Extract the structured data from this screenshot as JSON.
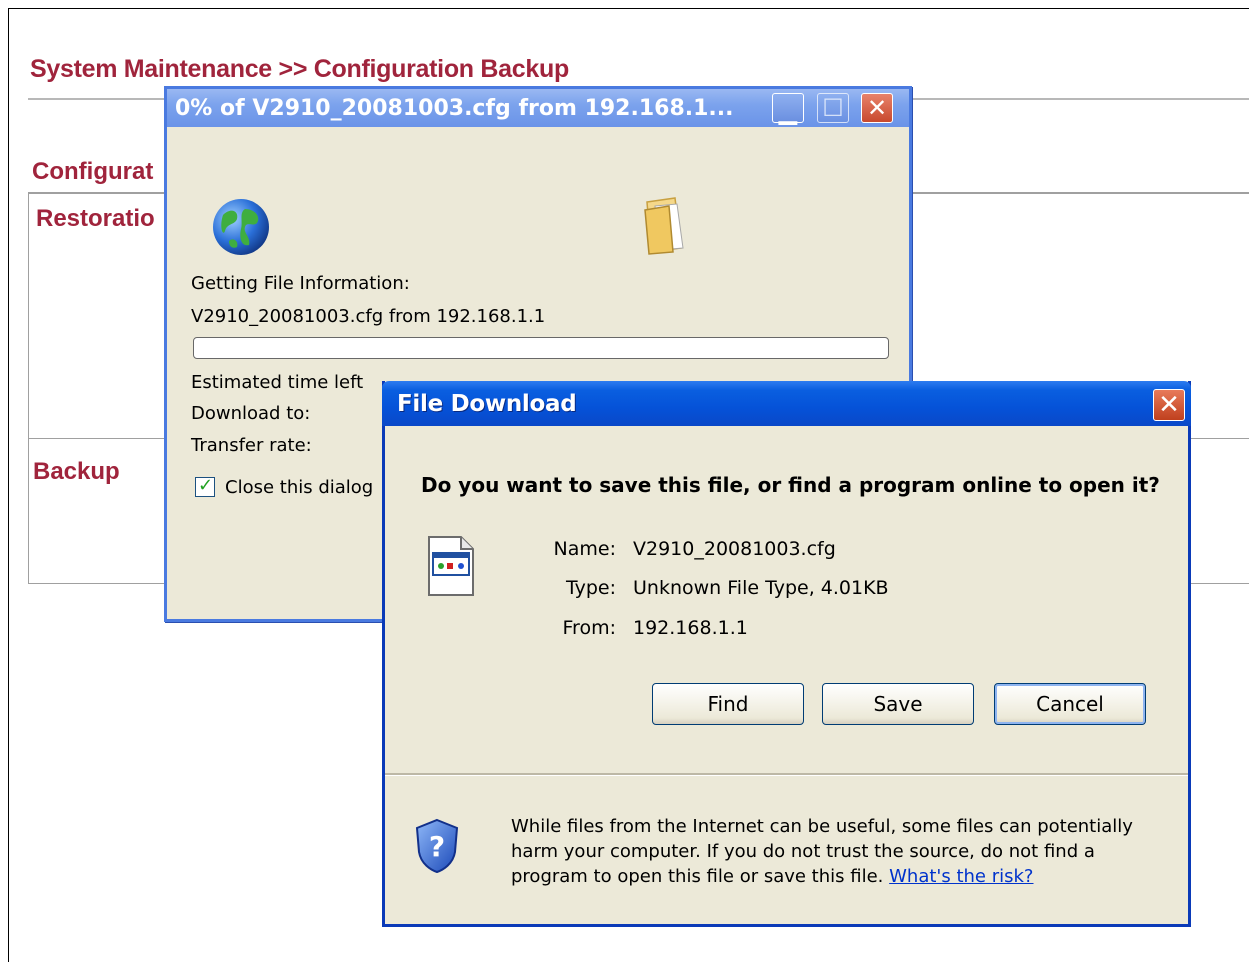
{
  "page": {
    "title": "System Maintenance >> Configuration Backup",
    "section_config": "Configurat",
    "section_restoration": "Restoratio",
    "section_backup": "Backup"
  },
  "progress_window": {
    "title": "0% of V2910_20081003.cfg from 192.168.1...",
    "status_label": "Getting File Information:",
    "file_source": "V2910_20081003.cfg from 192.168.1.1",
    "progress_percent": 0,
    "estimated_time_label": "Estimated time left",
    "download_to_label": "Download to:",
    "transfer_rate_label": "Transfer rate:",
    "close_dialog_label": "Close this dialog",
    "close_dialog_checked": true,
    "icons": {
      "globe": "globe-icon",
      "folder": "folder-icon"
    }
  },
  "file_download_dialog": {
    "title": "File Download",
    "question": "Do you want to save this file, or find a program online to open it?",
    "name_label": "Name:",
    "name_value": "V2910_20081003.cfg",
    "type_label": "Type:",
    "type_value": "Unknown File Type, 4.01KB",
    "from_label": "From:",
    "from_value": "192.168.1.1",
    "buttons": {
      "find": "Find",
      "save": "Save",
      "cancel": "Cancel"
    },
    "warning_text": "While files from the Internet can be useful, some files can potentially harm your computer. If you do not trust the source, do not find a program to open this file or save this file.",
    "risk_link": "What's the risk?"
  },
  "colors": {
    "heading": "#a0243c",
    "xp_face": "#ece9d8",
    "title_active": "#0552d8",
    "title_inactive": "#7ca3ed",
    "link": "#0033cc"
  }
}
